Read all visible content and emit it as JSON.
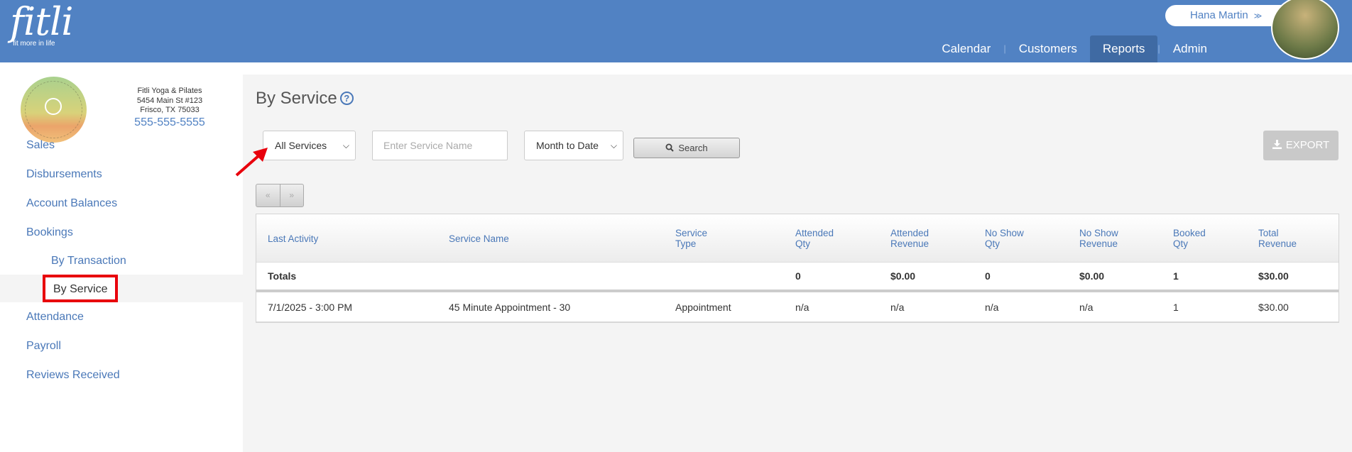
{
  "header": {
    "logo_word": "fitli",
    "logo_tagline": "fit more in life",
    "user_name": "Hana Martin",
    "nav": [
      {
        "label": "Calendar"
      },
      {
        "label": "Customers"
      },
      {
        "label": "Reports",
        "active": true
      },
      {
        "label": "Admin"
      }
    ]
  },
  "studio": {
    "name": "Fitli Yoga & Pilates",
    "address1": "5454 Main St #123",
    "address2": "Frisco, TX 75033",
    "phone": "555-555-5555"
  },
  "sidebar": {
    "items": [
      {
        "label": "Sales"
      },
      {
        "label": "Disbursements"
      },
      {
        "label": "Account Balances"
      },
      {
        "label": "Bookings"
      },
      {
        "label": "By Transaction"
      },
      {
        "label": "By Service",
        "active": true
      },
      {
        "label": "Attendance"
      },
      {
        "label": "Payroll"
      },
      {
        "label": "Reviews Received"
      }
    ]
  },
  "main": {
    "title": "By Service",
    "help_icon": "?",
    "filters": {
      "service_select": "All Services",
      "service_name_placeholder": "Enter Service Name",
      "date_select": "Month to Date",
      "search_label": "Search",
      "export_label": "EXPORT"
    },
    "pager": {
      "prev": "«",
      "next": "»"
    },
    "table": {
      "headers": [
        [
          "Last Activity"
        ],
        [
          "Service Name"
        ],
        [
          "Service",
          "Type"
        ],
        [
          "Attended",
          "Qty"
        ],
        [
          "Attended",
          "Revenue"
        ],
        [
          "No Show",
          "Qty"
        ],
        [
          "No Show",
          "Revenue"
        ],
        [
          "Booked",
          "Qty"
        ],
        [
          "Total",
          "Revenue"
        ]
      ],
      "totals": [
        "Totals",
        "",
        "",
        "0",
        "$0.00",
        "0",
        "$0.00",
        "1",
        "$30.00"
      ],
      "rows": [
        [
          "7/1/2025 - 3:00 PM",
          "45 Minute Appointment - 30",
          "Appointment",
          "n/a",
          "n/a",
          "n/a",
          "n/a",
          "1",
          "$30.00"
        ]
      ]
    }
  },
  "colors": {
    "header_bg": "#5182c3",
    "nav_active": "#3f6aa3",
    "link": "#4a78b8",
    "highlight": "#e8000c"
  }
}
